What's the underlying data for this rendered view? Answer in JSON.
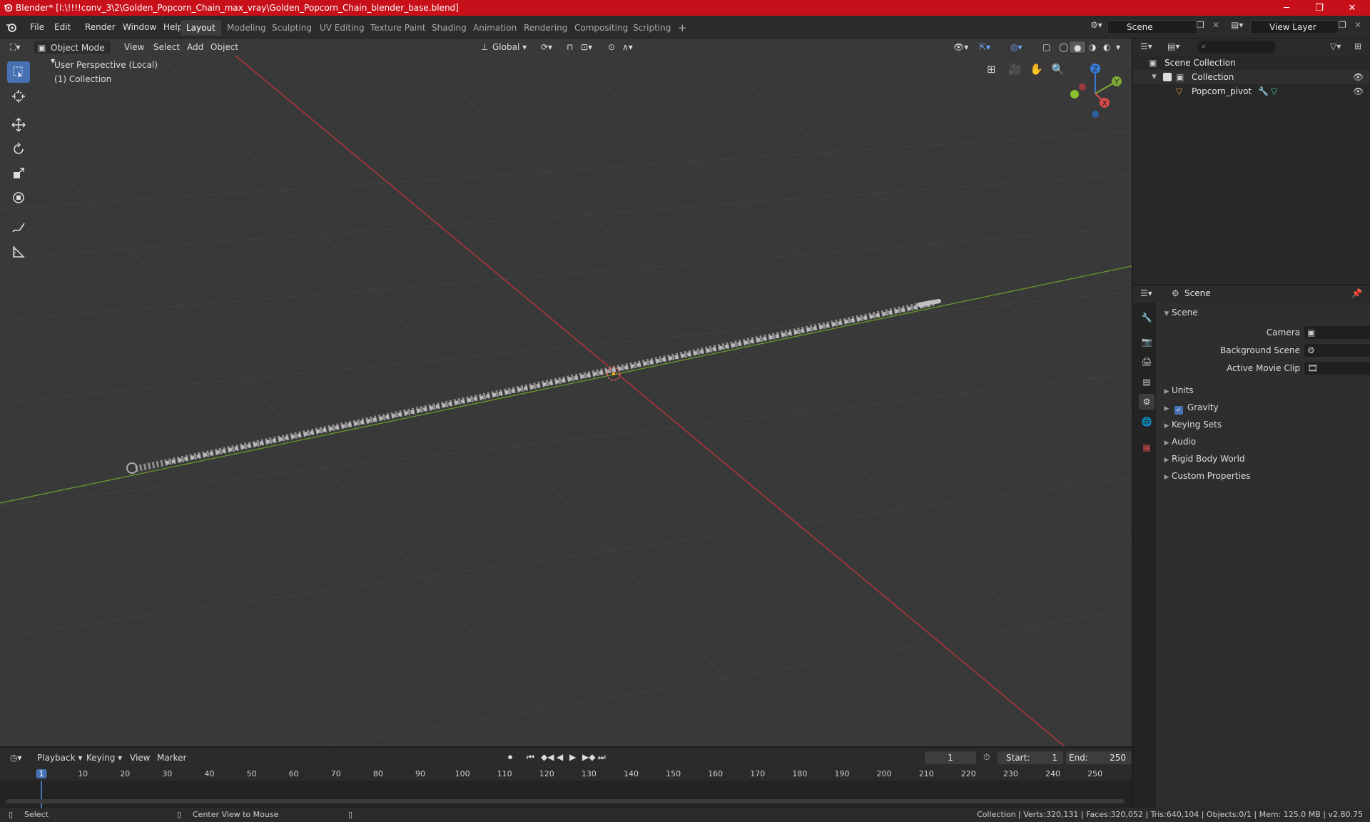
{
  "window": {
    "title": "Blender* [I:\\!!!!conv_3\\2\\Golden_Popcorn_Chain_max_vray\\Golden_Popcorn_Chain_blender_base.blend]",
    "minimize": "─",
    "maximize": "❐",
    "close": "✕"
  },
  "menu": {
    "items": [
      "File",
      "Edit",
      "Render",
      "Window",
      "Help"
    ]
  },
  "workspaces": {
    "tabs": [
      "Layout",
      "Modeling",
      "Sculpting",
      "UV Editing",
      "Texture Paint",
      "Shading",
      "Animation",
      "Rendering",
      "Compositing",
      "Scripting"
    ],
    "active": "Layout",
    "add": "+"
  },
  "scene_selector": {
    "value": "Scene"
  },
  "view_layer_selector": {
    "value": "View Layer"
  },
  "viewport": {
    "mode": "Object Mode",
    "menus": [
      "View",
      "Select",
      "Add",
      "Object"
    ],
    "transform_orientation": "Global",
    "overlay_line1": "User Perspective (Local)",
    "overlay_line2": "(1) Collection",
    "gizmo": {
      "z": "Z",
      "y": "Y",
      "x": "X"
    }
  },
  "outliner": {
    "search_placeholder": "",
    "root": "Scene Collection",
    "collection": "Collection",
    "object": "Popcorn_pivot"
  },
  "properties": {
    "header": "Scene",
    "panel": "Scene",
    "camera_label": "Camera",
    "background_scene_label": "Background Scene",
    "active_movie_clip_label": "Active Movie Clip",
    "sections": [
      "Units",
      "Gravity",
      "Keying Sets",
      "Audio",
      "Rigid Body World",
      "Custom Properties"
    ],
    "gravity_checked": true
  },
  "timeline": {
    "menus": [
      "Playback",
      "Keying",
      "View",
      "Marker"
    ],
    "current_frame": "1",
    "start_label": "Start:",
    "start_value": "1",
    "end_label": "End:",
    "end_value": "250",
    "ruler": [
      "1",
      "10",
      "20",
      "30",
      "40",
      "50",
      "60",
      "70",
      "80",
      "90",
      "100",
      "110",
      "120",
      "130",
      "140",
      "150",
      "160",
      "170",
      "180",
      "190",
      "200",
      "210",
      "220",
      "230",
      "240",
      "250"
    ]
  },
  "statusbar": {
    "left": "Select",
    "middle": "Center View to Mouse",
    "right": "Collection | Verts:320,131 | Faces:320,052 | Tris:640,104 | Objects:0/1 | Mem: 125.0 MB | v2.80.75"
  },
  "colors": {
    "titlebar": "#c8101a",
    "accent": "#4772b3",
    "x_axis": "#c4343d",
    "y_axis": "#6a9a2a"
  }
}
